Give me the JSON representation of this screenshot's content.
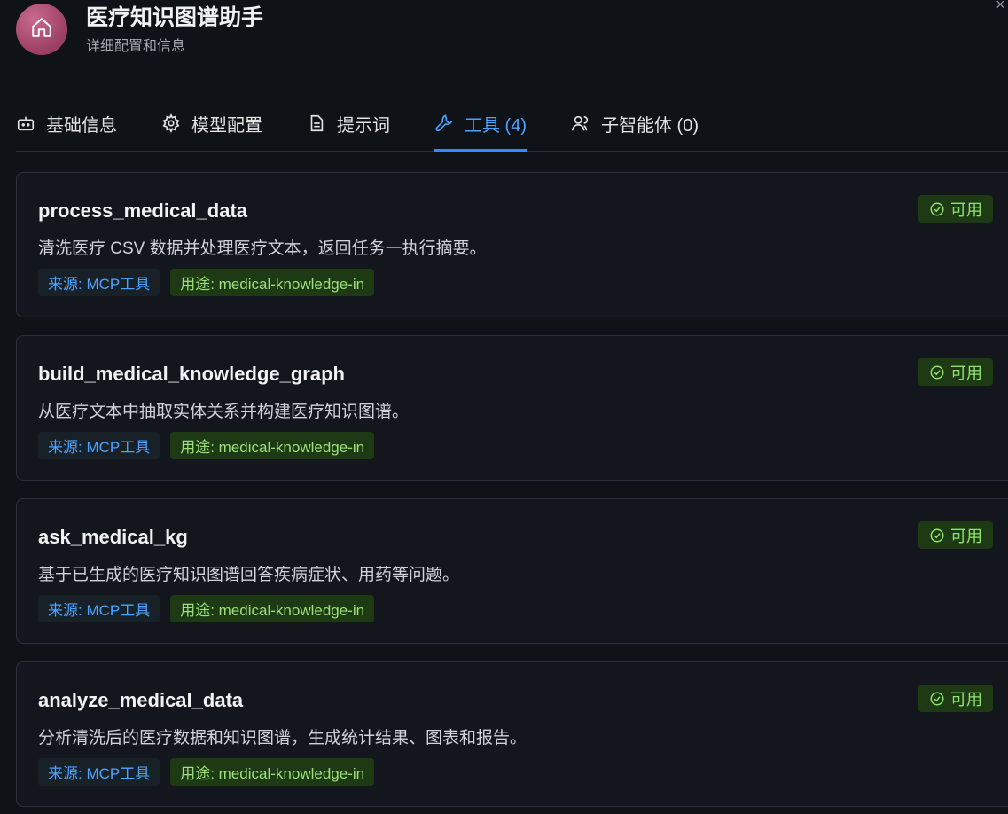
{
  "header": {
    "title": "医疗知识图谱助手",
    "subtitle": "详细配置和信息",
    "avatar_icon": "home-icon"
  },
  "close_icon": "close-icon",
  "tabs": [
    {
      "label": "基础信息",
      "icon": "bot-icon",
      "active": false
    },
    {
      "label": "模型配置",
      "icon": "gear-icon",
      "active": false
    },
    {
      "label": "提示词",
      "icon": "document-icon",
      "active": false
    },
    {
      "label": "工具 (4)",
      "icon": "wrench-icon",
      "active": true
    },
    {
      "label": "子智能体 (0)",
      "icon": "users-icon",
      "active": false
    }
  ],
  "tools": [
    {
      "name": "process_medical_data",
      "description": "清洗医疗 CSV 数据并处理医疗文本，返回任务一执行摘要。",
      "status": "可用",
      "source": "来源: MCP工具",
      "usage": "用途: medical-knowledge-in"
    },
    {
      "name": "build_medical_knowledge_graph",
      "description": "从医疗文本中抽取实体关系并构建医疗知识图谱。",
      "status": "可用",
      "source": "来源: MCP工具",
      "usage": "用途: medical-knowledge-in"
    },
    {
      "name": "ask_medical_kg",
      "description": "基于已生成的医疗知识图谱回答疾病症状、用药等问题。",
      "status": "可用",
      "source": "来源: MCP工具",
      "usage": "用途: medical-knowledge-in"
    },
    {
      "name": "analyze_medical_data",
      "description": "分析清洗后的医疗数据和知识图谱，生成统计结果、图表和报告。",
      "status": "可用",
      "source": "来源: MCP工具",
      "usage": "用途: medical-knowledge-in"
    }
  ],
  "colors": {
    "background": "#0f1217",
    "accent": "#2f8cff",
    "status_bg": "#1e3a14",
    "status_text": "#8fe36d"
  }
}
